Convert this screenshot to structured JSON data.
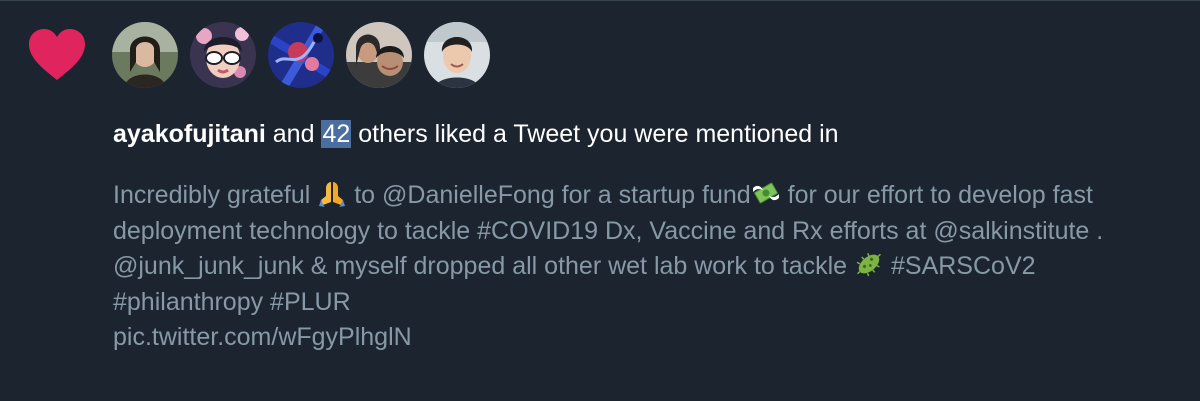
{
  "notification": {
    "type_icon": "heart-icon",
    "avatars": [
      {
        "name": "avatar-1",
        "colors": [
          "#d9d4c9",
          "#2b2622"
        ]
      },
      {
        "name": "avatar-2",
        "colors": [
          "#e8a5c4",
          "#1e1c2a"
        ]
      },
      {
        "name": "avatar-3",
        "colors": [
          "#1f2e8a",
          "#c73a5a"
        ]
      },
      {
        "name": "avatar-4",
        "colors": [
          "#b88e74",
          "#2a2a2a"
        ]
      },
      {
        "name": "avatar-5",
        "colors": [
          "#d9dfe2",
          "#202020"
        ]
      }
    ],
    "headline": {
      "username": "ayakofujitani",
      "and": "and",
      "count": "42",
      "rest": "others liked a Tweet you were mentioned in"
    },
    "tweet": {
      "part1": "Incredibly grateful",
      "emoji1": "folded-hands-icon",
      "part2": "to @DanielleFong for a startup fund",
      "emoji2": "money-with-wings-icon",
      "part3": "for our effort to develop fast deployment technology to tackle #COVID19 Dx, Vaccine and Rx efforts at @salkinstitute . @junk_junk_junk & myself dropped all other wet lab work to tackle",
      "emoji3": "microbe-icon",
      "part4": "#SARSCoV2 #philanthropy #PLUR",
      "link": "pic.twitter.com/wFgyPlhglN"
    },
    "colors": {
      "background": "#1c2430",
      "heart": "#e0245e",
      "text_primary": "#ffffff",
      "text_secondary": "#8899a6",
      "highlight": "#4a6ea0"
    }
  }
}
